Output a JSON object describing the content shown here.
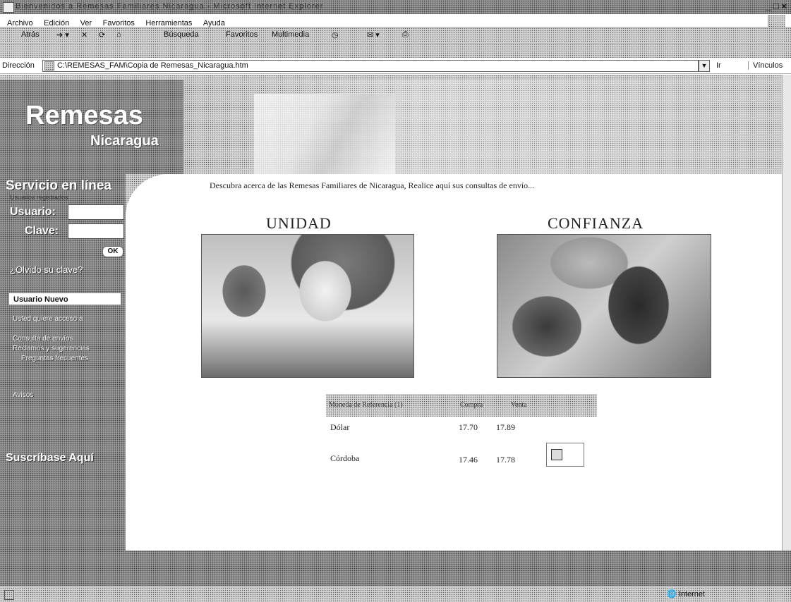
{
  "window": {
    "title": "Bienvenidos a Remesas Familiares Nicaragua - Microsoft Internet Explorer",
    "controls": "_ □ ×"
  },
  "menu": [
    "Archivo",
    "Edición",
    "Ver",
    "Favoritos",
    "Herramientas",
    "Ayuda"
  ],
  "toolbar": {
    "back": "Atrás",
    "search": "Búsqueda",
    "favorites": "Favoritos",
    "media": "Multimedia"
  },
  "address": {
    "label": "Dirección",
    "url": "C:\\REMESAS_FAM\\Copia de Remesas_Nicaragua.htm",
    "go": "Ir",
    "links": "Vínculos"
  },
  "banner": {
    "title": "Remesas",
    "subtitle": "Nicaragua"
  },
  "sidebar": {
    "service_title": "Servicio en línea",
    "service_sub": "Usuarios registrados",
    "user_label": "Usuario:",
    "pass_label": "Clave:",
    "ok": "OK",
    "forgot": "¿Olvido su clave?",
    "new_user": "Usuario Nuevo",
    "links": [
      "Usted quiere acceso a",
      "Consulta de envíos",
      "Reclamos y sugerencias",
      "Preguntas frecuentes",
      "Avisos"
    ],
    "subscribe": "Suscríbase Aquí"
  },
  "main": {
    "tagline": "Descubra acerca de las Remesas Familiares de Nicaragua, Realice aquí sus consultas de envío...",
    "pictures": [
      {
        "title": "UNIDAD"
      },
      {
        "title": "CONFIANZA"
      }
    ]
  },
  "rates": {
    "headers": [
      "Moneda de Referencia (1)",
      "Compra",
      "Venta"
    ],
    "rows": [
      {
        "currency": "Dólar",
        "buy": "17.70",
        "sell": "17.89"
      },
      {
        "currency": "Córdoba",
        "buy": "17.46",
        "sell": "17.78"
      }
    ]
  },
  "status": {
    "zone": "Internet"
  }
}
